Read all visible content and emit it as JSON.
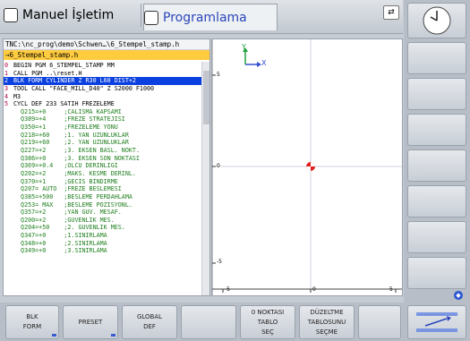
{
  "header": {
    "tab_manual": "Manuel İşletim",
    "tab_program": "Programlama",
    "toggle_icon": "split-view-toggle-icon"
  },
  "editor": {
    "path": "TNC:\\nc_prog\\demo\\Schwen…\\6_Stempel_stamp.h",
    "file": "→6_Stempel_stamp.h",
    "lines": [
      {
        "n": "0",
        "t": "BEGIN PGM 6_STEMPEL_STAMP MM"
      },
      {
        "n": "1",
        "t": "CALL PGM ..\\reset.H"
      },
      {
        "n": "2",
        "t": "BLK FORM CYLINDER Z R30 L60 DIST+2",
        "sel": true
      },
      {
        "n": "3",
        "t": "TOOL CALL \"FACE_MILL_D40\" Z S2000 F1000"
      },
      {
        "n": "4",
        "t": "M3"
      },
      {
        "n": "5",
        "t": "CYCL DEF 233 SATIH FREZELEME"
      },
      {
        "n": "",
        "t": "  Q215=+0     ;CALISMA KAPSAMI"
      },
      {
        "n": "",
        "t": "  Q389=+4     ;FREZE STRATEJISI"
      },
      {
        "n": "",
        "t": "  Q350=+1     ;FREZELEME YONU"
      },
      {
        "n": "",
        "t": "  Q218=+60    ;1. YAN UZUNLUKLAR"
      },
      {
        "n": "",
        "t": "  Q219=+60    ;2. YAN UZUNLUKLAR"
      },
      {
        "n": "",
        "t": "  Q227=+2     ;3. EKSEN BASL. NOKT."
      },
      {
        "n": "",
        "t": "  Q386=+0     ;3. EKSEN SON NOKTASI"
      },
      {
        "n": "",
        "t": "  Q369=+0.4   ;OLCU DERINLIGI"
      },
      {
        "n": "",
        "t": "  Q202=+2     ;MAKS. KESME DERINL."
      },
      {
        "n": "",
        "t": "  Q370=+1     ;GECIS BINDIRME"
      },
      {
        "n": "",
        "t": "  Q207= AUTO  ;FREZE BESLEMESI"
      },
      {
        "n": "",
        "t": "  Q385=+500   ;BESLEME PERDAHLAMA"
      },
      {
        "n": "",
        "t": "  Q253= MAX   ;BESLEME POZISYONL."
      },
      {
        "n": "",
        "t": "  Q357=+2     ;YAN GUV. MESAF."
      },
      {
        "n": "",
        "t": "  Q200=+2     ;GUVENLIK MES."
      },
      {
        "n": "",
        "t": "  Q204=+50    ;2. GUVENLIK MES."
      },
      {
        "n": "",
        "t": "  Q347=+0     ;1.SINIRLAMA"
      },
      {
        "n": "",
        "t": "  Q348=+0     ;2.SINIRLAMA"
      },
      {
        "n": "",
        "t": "  Q349=+0     ;3.SINIRLAMA"
      }
    ]
  },
  "graphic": {
    "axis_x": "X",
    "axis_y": "Y",
    "ruler_left": [
      "5",
      "0",
      "-5"
    ],
    "ruler_bottom": [
      "-5",
      "0",
      "5"
    ]
  },
  "softkeys": [
    {
      "l1": "BLK",
      "l2": "FORM"
    },
    {
      "l1": "PRESET",
      "l2": ""
    },
    {
      "l1": "GLOBAL",
      "l2": "DEF"
    },
    {
      "l1": "",
      "l2": ""
    },
    {
      "l1": "0 NOKTASI",
      "l2": "TABLO",
      "l3": "SEÇ"
    },
    {
      "l1": "DÜZELTME",
      "l2": "TABLOSUNU",
      "l3": "SEÇME"
    },
    {
      "l1": "",
      "l2": ""
    }
  ],
  "colors": {
    "selection": "#0a40e0",
    "line_numbers": "#b0004a",
    "comments": "#208020",
    "keywords": "#202020",
    "file_highlight": "#ffcc40"
  }
}
